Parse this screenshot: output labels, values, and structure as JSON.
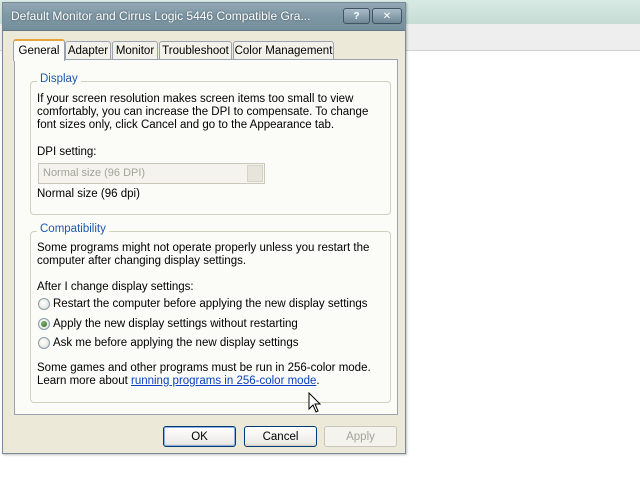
{
  "window": {
    "title": "Default Monitor and Cirrus Logic 5446 Compatible Gra...",
    "help_label": "?",
    "close_label": "✕"
  },
  "tabs": [
    {
      "label": "General",
      "active": true
    },
    {
      "label": "Adapter"
    },
    {
      "label": "Monitor"
    },
    {
      "label": "Troubleshoot"
    },
    {
      "label": "Color Management"
    }
  ],
  "display": {
    "title": "Display",
    "description_lines": [
      "If your screen resolution makes screen items too small to view",
      "comfortably, you can increase the DPI to compensate.  To change",
      "font sizes only, click Cancel and go to the Appearance tab."
    ],
    "dpi_label": "DPI setting:",
    "dpi_selected": "Normal size (96 DPI)",
    "dpi_note": "Normal size (96 dpi)"
  },
  "compatibility": {
    "title": "Compatibility",
    "description_lines": [
      "Some programs might not operate properly unless you restart the",
      "computer after changing display settings."
    ],
    "after_label": "After I change display settings:",
    "options": [
      {
        "label": "Restart the computer before applying the new display settings",
        "selected": false
      },
      {
        "label": "Apply the new display settings without restarting",
        "selected": true
      },
      {
        "label": "Ask me before applying the new display settings",
        "selected": false
      }
    ],
    "games_note": "Some games and other programs must be run in 256-color mode.",
    "learn_more_prefix": "Learn more about ",
    "learn_more_link": "running programs in 256-color mode",
    "learn_more_suffix": "."
  },
  "buttons": {
    "ok": "OK",
    "cancel": "Cancel",
    "apply": "Apply"
  }
}
